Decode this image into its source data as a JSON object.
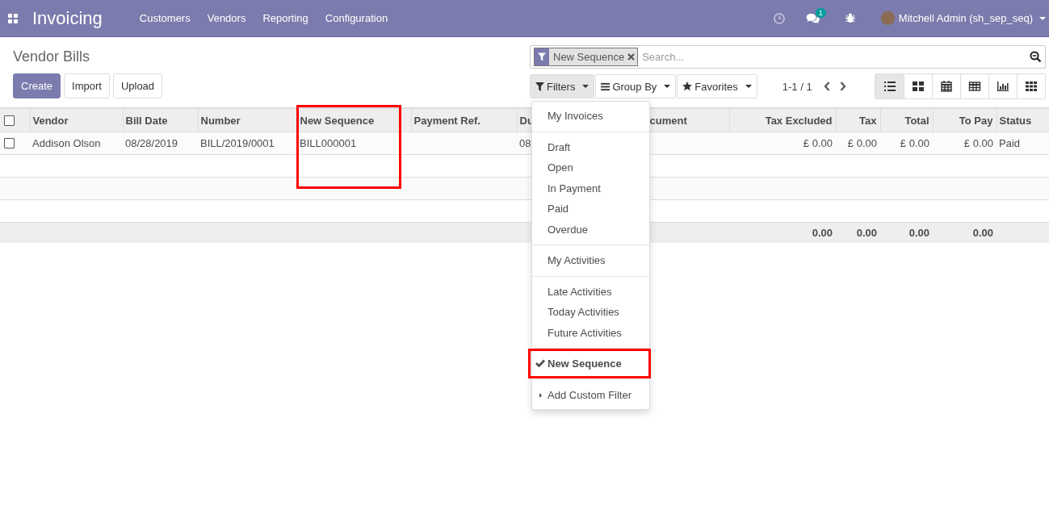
{
  "navbar": {
    "brand": "Invoicing",
    "menu": [
      "Customers",
      "Vendors",
      "Reporting",
      "Configuration"
    ],
    "message_count": "1",
    "user": "Mitchell Admin (sh_sep_seq)"
  },
  "page": {
    "title": "Vendor Bills",
    "buttons": [
      {
        "label": "Create",
        "kind": "primary"
      },
      {
        "label": "Import",
        "kind": "secondary"
      },
      {
        "label": "Upload",
        "kind": "secondary"
      }
    ]
  },
  "search": {
    "facet": "New Sequence",
    "placeholder": "Search..."
  },
  "search_buttons": [
    {
      "label": "Filters",
      "kind": "filter",
      "selected": true
    },
    {
      "label": "Group By",
      "kind": "groupby",
      "selected": false
    },
    {
      "label": "Favorites",
      "kind": "star",
      "selected": false
    }
  ],
  "pager": "1-1 / 1",
  "view_switcher": [
    {
      "kind": "list",
      "selected": true
    },
    {
      "kind": "kanban",
      "selected": false
    },
    {
      "kind": "calendar",
      "selected": false
    },
    {
      "kind": "pivot",
      "selected": false
    },
    {
      "kind": "graph",
      "selected": false
    },
    {
      "kind": "grid",
      "selected": false
    }
  ],
  "table": {
    "all_checked": false,
    "columns": [
      {
        "label": "Vendor",
        "kind": "text"
      },
      {
        "label": "Bill Date",
        "kind": "text"
      },
      {
        "label": "Number",
        "kind": "text"
      },
      {
        "label": "New Sequence",
        "kind": "text"
      },
      {
        "label": "Payment Ref.",
        "kind": "text"
      },
      {
        "label": "Du",
        "kind": "text"
      },
      {
        "label": "cument",
        "kind": "text"
      },
      {
        "label": "Tax Excluded",
        "kind": "number",
        "total": "0.00"
      },
      {
        "label": "Tax",
        "kind": "number",
        "total": "0.00"
      },
      {
        "label": "Total",
        "kind": "number",
        "total": "0.00"
      },
      {
        "label": "To Pay",
        "kind": "number",
        "total": "0.00"
      },
      {
        "label": "Status",
        "kind": "text"
      }
    ],
    "rows": [
      {
        "selected": false,
        "cells": [
          "Addison Olson",
          "08/28/2019",
          "BILL/2019/0001",
          "BILL000001",
          null,
          "08",
          null,
          "£ 0.00",
          "£ 0.00",
          "£ 0.00",
          "£ 0.00",
          "Paid"
        ]
      }
    ]
  },
  "filters_menu": {
    "groups": [
      [
        {
          "label": "My Invoices",
          "checked": false
        }
      ],
      [
        {
          "label": "Draft",
          "checked": false
        },
        {
          "label": "Open",
          "checked": false
        },
        {
          "label": "In Payment",
          "checked": false
        },
        {
          "label": "Paid",
          "checked": false
        },
        {
          "label": "Overdue",
          "checked": false
        }
      ],
      [
        {
          "label": "My Activities",
          "checked": false
        }
      ],
      [
        {
          "label": "Late Activities",
          "checked": false
        },
        {
          "label": "Today Activities",
          "checked": false
        },
        {
          "label": "Future Activities",
          "checked": false
        }
      ],
      [
        {
          "label": "New Sequence",
          "checked": true
        }
      ]
    ],
    "custom_filter": "Add Custom Filter"
  }
}
